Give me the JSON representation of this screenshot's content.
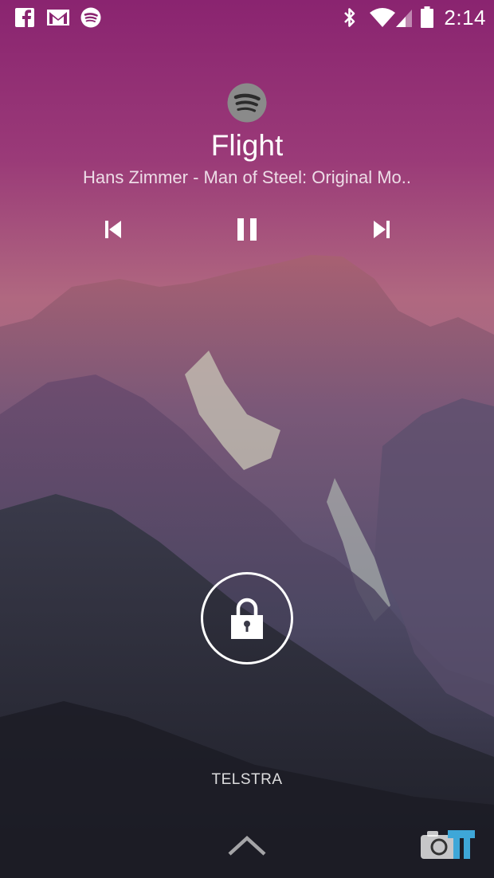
{
  "status_bar": {
    "time": "2:14",
    "notification_icons": [
      "facebook-icon",
      "gmail-icon",
      "spotify-icon"
    ],
    "system_icons": [
      "bluetooth-icon",
      "wifi-icon",
      "signal-icon",
      "battery-icon"
    ]
  },
  "media": {
    "app_icon": "spotify-icon",
    "title": "Flight",
    "subtitle": "Hans Zimmer - Man of Steel: Original Mo..",
    "controls": [
      "previous-icon",
      "pause-icon",
      "next-icon"
    ]
  },
  "lock": {
    "icon": "lock-icon"
  },
  "carrier": "TELSTRA",
  "bottom": {
    "icon": "chevron-up-icon",
    "watermark": "camera-icon"
  },
  "colors": {
    "sky_top": "#8e2a6e",
    "sky_bottom": "#b96a86",
    "text": "#ffffff"
  }
}
